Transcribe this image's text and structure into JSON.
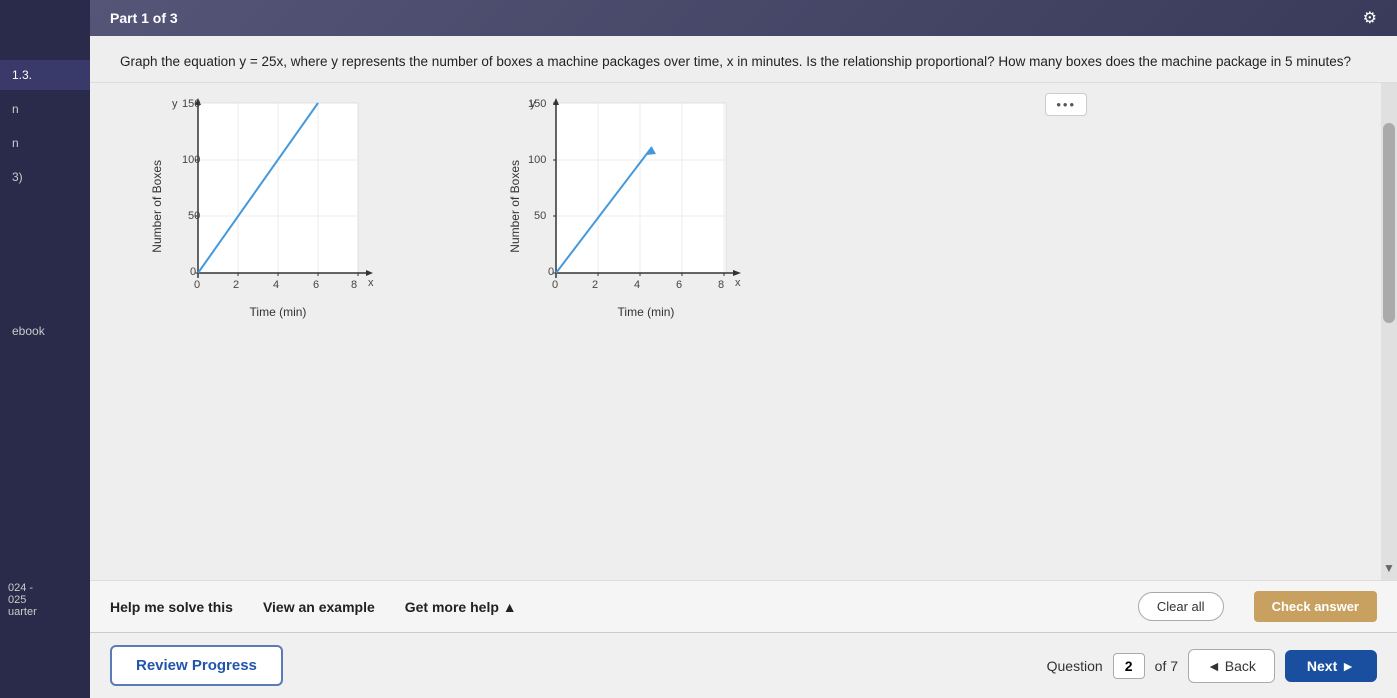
{
  "header": {
    "part_label": "Part 1 of 3"
  },
  "question": {
    "number": "1.3.",
    "text": "Graph the equation y = 25x, where y represents the number of boxes a machine packages over time, x in minutes. Is the relationship proportional? How many boxes does the machine package in 5 minutes?"
  },
  "dots_button": "...",
  "graphs": [
    {
      "y_label": "Number of Boxes",
      "x_label": "Time (min)",
      "y_ticks": [
        "150",
        "100",
        "50",
        "0"
      ],
      "x_ticks": [
        "0",
        "2",
        "4",
        "6",
        "8"
      ],
      "has_line": true,
      "line_from": [
        0,
        0
      ],
      "line_to": [
        6,
        150
      ]
    },
    {
      "y_label": "Number of Boxes",
      "x_label": "Time (min)",
      "y_ticks": [
        "150",
        "100",
        "50",
        "0"
      ],
      "x_ticks": [
        "0",
        "2",
        "4",
        "6",
        "8"
      ],
      "has_line": true,
      "line_from": [
        0,
        0
      ],
      "line_to": [
        4.5,
        112
      ]
    }
  ],
  "toolbar": {
    "help_me_solve": "Help me solve this",
    "view_example": "View an example",
    "get_more_help": "Get more help ▲",
    "clear_all": "Clear all",
    "check_answer": "Check answer"
  },
  "footer": {
    "review_progress": "Review Progress",
    "question_label": "Question",
    "question_number": "2",
    "of_label": "of 7",
    "back_label": "◄ Back",
    "next_label": "Next ►"
  },
  "sidebar": {
    "items": [
      {
        "label": "1.3.",
        "active": true
      },
      {
        "label": "n",
        "active": false
      },
      {
        "label": "n",
        "active": false
      },
      {
        "label": "3)",
        "active": false
      },
      {
        "label": "ebook",
        "active": false
      }
    ]
  },
  "bottom_sidebar": {
    "items": [
      {
        "label": "024 -"
      },
      {
        "label": "025"
      },
      {
        "label": "uarter"
      }
    ]
  },
  "icons": {
    "gear": "⚙",
    "back_arrow": "◄",
    "next_arrow": "►",
    "dots": "•••"
  }
}
